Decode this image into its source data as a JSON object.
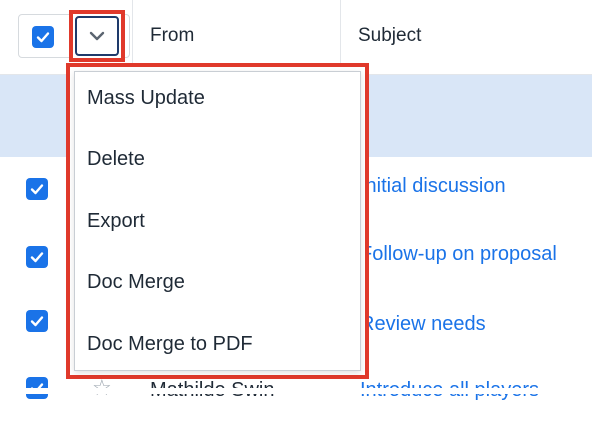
{
  "header": {
    "select_all_checked": true,
    "from_label": "From",
    "subject_label": "Subject"
  },
  "dropdown": {
    "items": [
      "Mass Update",
      "Delete",
      "Export",
      "Doc Merge",
      "Doc Merge to PDF"
    ]
  },
  "rows": [
    {
      "checked": true,
      "subject": "Initial discussion"
    },
    {
      "checked": true,
      "subject": "Follow-up on proposal"
    },
    {
      "checked": true,
      "subject": "Review needs"
    },
    {
      "checked": true,
      "from": "Mathilde Swin",
      "subject": "Introduce all players"
    }
  ],
  "colors": {
    "accent": "#1a73e8",
    "highlight_border": "#e0392b",
    "selected_row": "#d9e6f7"
  },
  "icons": {
    "dropdown": "chevron-down-icon",
    "favorite": "star-icon",
    "checkbox": "check-icon"
  }
}
